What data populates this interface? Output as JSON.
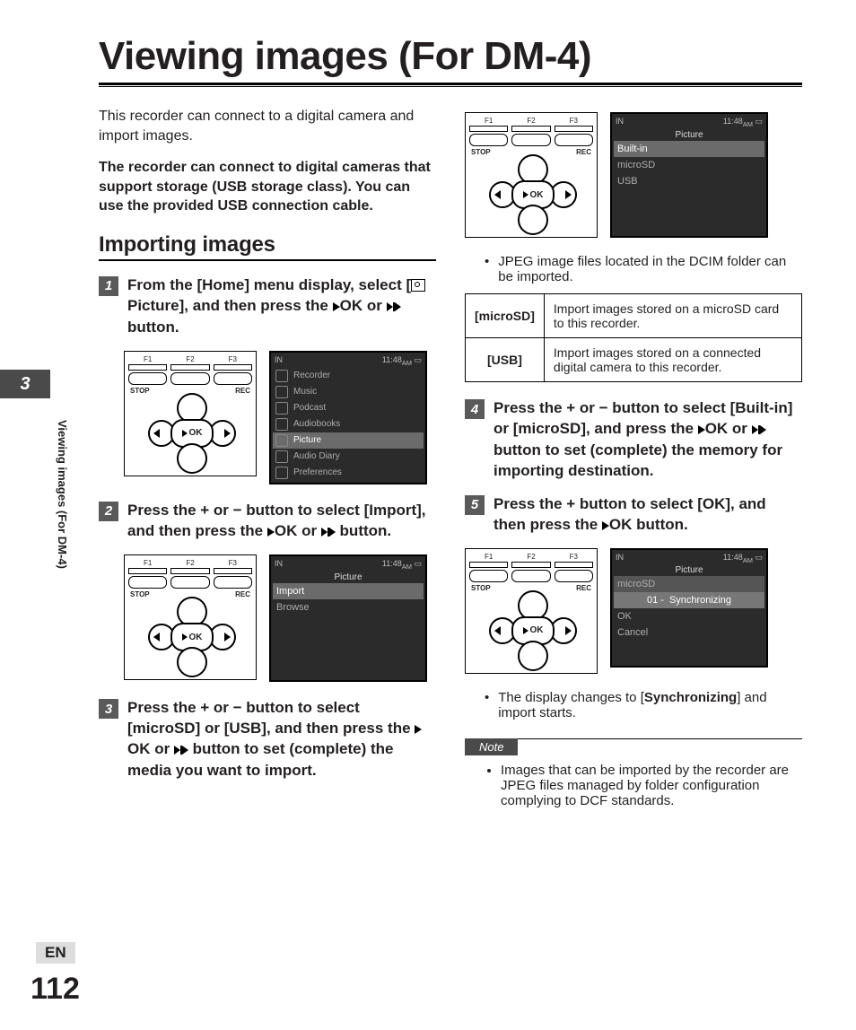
{
  "title": "Viewing images (For DM-4)",
  "intro": "This recorder can connect to a digital camera and import images.",
  "intro_bold": "The recorder can connect to digital cameras that support storage (USB storage class). You can use the provided USB connection cable.",
  "section": "Importing images",
  "steps": {
    "s1": {
      "pre": "From the [",
      "home": "Home",
      "mid": "] menu display, select [",
      "pic": "Picture",
      "mid2": "], and then press the ",
      "ok": "OK",
      " or": " or ",
      "btn": " button."
    },
    "s2": {
      "pre": "Press the + or − button to select [",
      "imp": "Import",
      "post": "], and then press the ",
      "ok": "OK",
      "or": " or ",
      "btn": " button."
    },
    "s3": {
      "pre": "Press the + or − button to select [",
      "a": "microSD",
      "mid": "] or [",
      "b": "USB",
      "post": "], and then press the ",
      "ok": "OK",
      "or": " or ",
      "btn": " button to set (complete) the media you want to import."
    },
    "s4": {
      "pre": "Press the + or − button to select [",
      "a": "Built-in",
      "mid": "] or [",
      "b": "microSD",
      "post": "], and press the ",
      "ok": "OK",
      "or": " or ",
      "btn": " button to set (complete) the memory for importing destination."
    },
    "s5": {
      "pre": "Press the + button to select [",
      "a": "OK",
      "post": "], and then press the ",
      "ok": "OK",
      "btn": " button."
    }
  },
  "bullet_dcim": "JPEG image files located in the DCIM folder can be imported.",
  "table": {
    "r1k": "[microSD]",
    "r1v": "Import images stored on a microSD card to this recorder.",
    "r2k": "[USB]",
    "r2v": "Import images stored on a connected digital camera to this recorder."
  },
  "bullet_sync_pre": "The display changes to [",
  "bullet_sync_b": "Synchronizing",
  "bullet_sync_post": "] and import starts.",
  "note_label": "Note",
  "note_text": "Images that can be imported by the recorder are JPEG files managed by folder configuration complying to DCF standards.",
  "side": {
    "chapter": "3",
    "label": "Viewing images (For DM-4)",
    "lang": "EN",
    "page": "112"
  },
  "ui": {
    "ok": "OK",
    "stop": "STOP",
    "rec": "REC",
    "f1": "F1",
    "f2": "F2",
    "f3": "F3",
    "time": "11:48",
    "am": "AM",
    "in": "IN",
    "menu": [
      "Recorder",
      "Music",
      "Podcast",
      "Audiobooks",
      "Picture",
      "Audio Diary",
      "Preferences"
    ],
    "picture": "Picture",
    "pic_opts": [
      "Import",
      "Browse"
    ],
    "sources": [
      "Built-in",
      "microSD",
      "USB"
    ],
    "sync": "Synchronizing",
    "sync_ok": "OK",
    "sync_cancel": "Cancel"
  }
}
